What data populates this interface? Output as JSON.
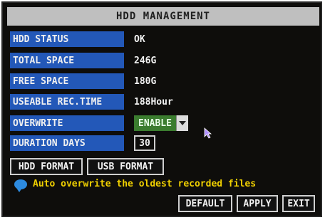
{
  "title": "HDD MANAGEMENT",
  "fields": [
    {
      "label": "HDD STATUS",
      "value": "OK"
    },
    {
      "label": "TOTAL SPACE",
      "value": "246G"
    },
    {
      "label": "FREE SPACE",
      "value": "180G"
    },
    {
      "label": "USEABLE REC.TIME",
      "value": "188Hour"
    }
  ],
  "overwrite": {
    "label": "OVERWRITE",
    "value": "ENABLE"
  },
  "duration": {
    "label": "DURATION DAYS",
    "value": "30"
  },
  "buttons": {
    "hdd_format": "HDD FORMAT",
    "usb_format": "USB FORMAT",
    "default": "DEFAULT",
    "apply": "APPLY",
    "exit": "EXIT"
  },
  "info_text": "Auto overwrite the oldest recorded files",
  "colors": {
    "label_bg": "#2358b8",
    "select_bg": "#3b7c2f",
    "info_text": "#f0d000",
    "title_bg": "#bfbfbf"
  },
  "icons": {
    "info": "info-bubble-icon",
    "cursor": "mouse-pointer-icon"
  }
}
